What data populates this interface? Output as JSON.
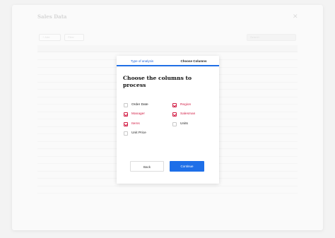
{
  "window": {
    "title": "Sales Data",
    "close_glyph": "✕",
    "toolbar": [
      {
        "label": "+ Add"
      },
      {
        "label": "Filter"
      }
    ],
    "search_placeholder": "Search"
  },
  "modal": {
    "tabs": [
      {
        "label": "Type of analysis",
        "active": false
      },
      {
        "label": "Choose Columns",
        "active": true
      }
    ],
    "heading": "Choose the columns to process",
    "options": [
      {
        "label": "Order Date",
        "checked": false
      },
      {
        "label": "Region",
        "checked": true
      },
      {
        "label": "Manager",
        "checked": true
      },
      {
        "label": "Salesman",
        "checked": true
      },
      {
        "label": "Items",
        "checked": true
      },
      {
        "label": "Units",
        "checked": false
      },
      {
        "label": "Unit Price",
        "checked": false
      }
    ],
    "back_label": "Back",
    "continue_label": "Continue"
  },
  "colors": {
    "accent_blue": "#1e6fe8",
    "checked_red": "#d21f46"
  }
}
